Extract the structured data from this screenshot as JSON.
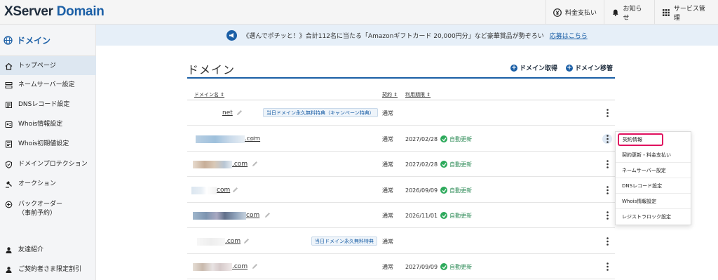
{
  "app": {
    "logo_prefix": "XServer",
    "logo_accent": "Domain",
    "colors": {
      "primary": "#1b5fa6",
      "highlight": "#e0115f",
      "success": "#2eaa5c"
    }
  },
  "topbar": {
    "payment_label": "料金支払い",
    "notice_label": "お知らせ",
    "services_label": "サービス管理"
  },
  "sidebar": {
    "header": "ドメイン",
    "items": [
      {
        "label": "トップページ",
        "icon": "home-icon"
      },
      {
        "label": "ネームサーバー設定",
        "icon": "server-icon"
      },
      {
        "label": "DNSレコード設定",
        "icon": "dns-icon"
      },
      {
        "label": "Whois情報設定",
        "icon": "whois-icon"
      },
      {
        "label": "Whois初期値設定",
        "icon": "whois-default-icon"
      },
      {
        "label": "ドメインプロテクション",
        "icon": "shield-icon"
      },
      {
        "label": "オークション",
        "icon": "auction-icon"
      },
      {
        "label": "バックオーダー",
        "icon": "backorder-icon"
      },
      {
        "label": "（事前予約）",
        "icon": ""
      },
      {
        "label": "友達紹介",
        "icon": "friend-icon"
      },
      {
        "label": "ご契約者さま限定割引",
        "icon": "discount-icon"
      }
    ]
  },
  "banner": {
    "text": "《選んでポチッと！》合計112名に当たる「Amazonギフトカード 20,000円分」など豪華賞品が勢ぞろい",
    "link": "応募はこちら"
  },
  "main": {
    "title": "ドメイン",
    "actions": {
      "acquire": "ドメイン取得",
      "transfer": "ドメイン移管"
    },
    "columns": {
      "domain": "ドメイン名 ⇕",
      "contract": "契約 ⇕",
      "expiry": "利用期限 ⇕"
    }
  },
  "rows": [
    {
      "domain": "net",
      "badge": "当日ドメイン永久無料特典（キャンペーン特典）",
      "contract": "通常",
      "expiry": "",
      "auto": ""
    },
    {
      "domain": ".com",
      "badge": "",
      "contract": "通常",
      "expiry": "2027/02/28",
      "auto": "自動更新"
    },
    {
      "domain": ".com",
      "badge": "",
      "contract": "通常",
      "expiry": "2027/02/28",
      "auto": "自動更新"
    },
    {
      "domain": "com",
      "badge": "",
      "contract": "通常",
      "expiry": "2026/09/09",
      "auto": "自動更新"
    },
    {
      "domain": "com",
      "badge": "",
      "contract": "通常",
      "expiry": "2026/11/01",
      "auto": "自動更新"
    },
    {
      "domain": ".com",
      "badge": "当日ドメイン永久無料特典",
      "contract": "通常",
      "expiry": "",
      "auto": ""
    },
    {
      "domain": ".com",
      "badge": "",
      "contract": "通常",
      "expiry": "2027/09/09",
      "auto": "自動更新"
    }
  ],
  "menu": {
    "items": [
      "契約情報",
      "契約更新・料金支払い",
      "ネームサーバー設定",
      "DNSレコード設定",
      "Whois情報設定",
      "レジストラロック設定"
    ]
  }
}
